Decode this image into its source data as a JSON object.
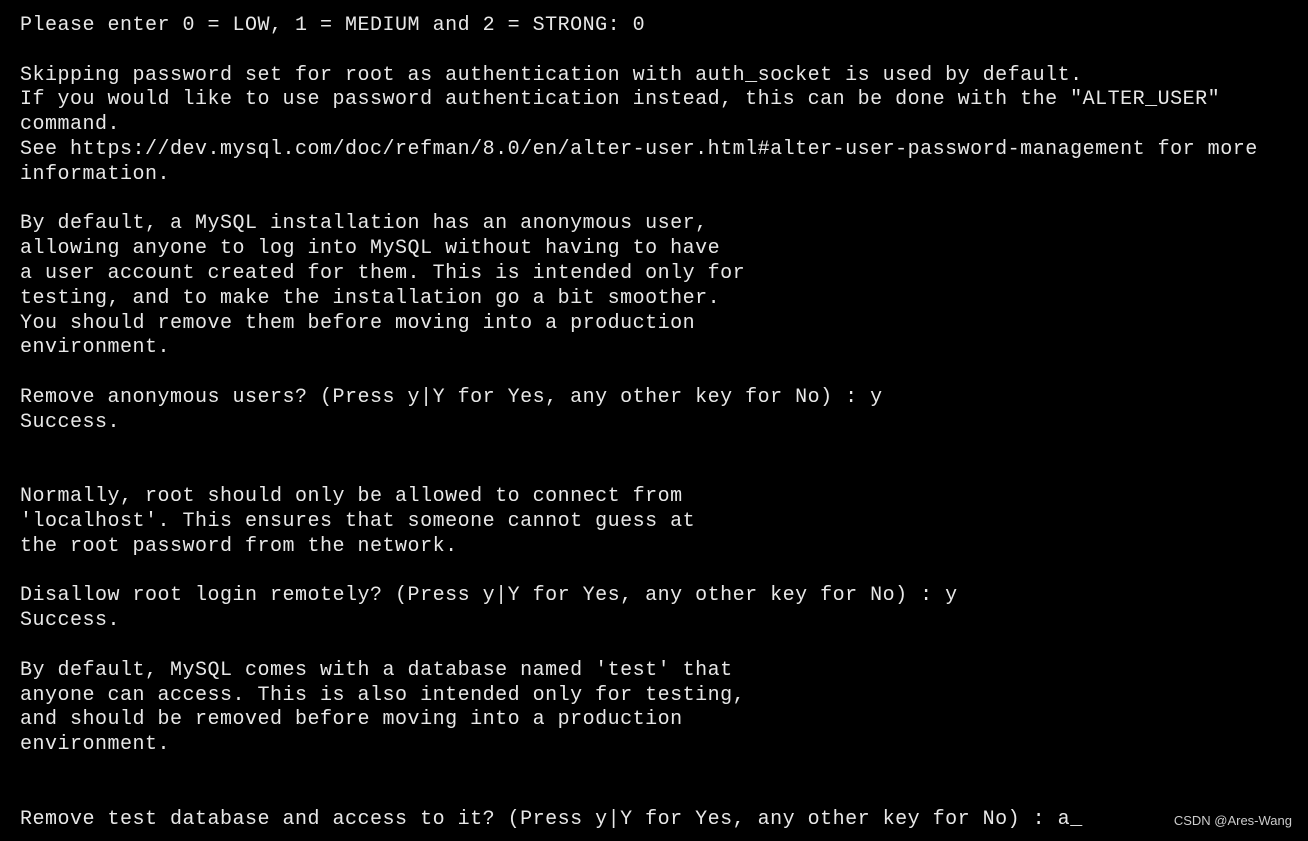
{
  "terminal": {
    "lines": [
      {
        "type": "prompt",
        "text": "Please enter 0 = LOW, 1 = MEDIUM and 2 = STRONG: ",
        "input": "0"
      },
      {
        "type": "blank"
      },
      {
        "type": "text",
        "text": "Skipping password set for root as authentication with auth_socket is used by default."
      },
      {
        "type": "text",
        "text": "If you would like to use password authentication instead, this can be done with the \"ALTER_USER\" command."
      },
      {
        "type": "text",
        "text": "See https://dev.mysql.com/doc/refman/8.0/en/alter-user.html#alter-user-password-management for more information."
      },
      {
        "type": "blank"
      },
      {
        "type": "text",
        "text": "By default, a MySQL installation has an anonymous user,"
      },
      {
        "type": "text",
        "text": "allowing anyone to log into MySQL without having to have"
      },
      {
        "type": "text",
        "text": "a user account created for them. This is intended only for"
      },
      {
        "type": "text",
        "text": "testing, and to make the installation go a bit smoother."
      },
      {
        "type": "text",
        "text": "You should remove them before moving into a production"
      },
      {
        "type": "text",
        "text": "environment."
      },
      {
        "type": "blank"
      },
      {
        "type": "prompt",
        "text": "Remove anonymous users? (Press y|Y for Yes, any other key for No) : ",
        "input": "y"
      },
      {
        "type": "text",
        "text": "Success."
      },
      {
        "type": "blank"
      },
      {
        "type": "blank"
      },
      {
        "type": "text",
        "text": "Normally, root should only be allowed to connect from"
      },
      {
        "type": "text",
        "text": "'localhost'. This ensures that someone cannot guess at"
      },
      {
        "type": "text",
        "text": "the root password from the network."
      },
      {
        "type": "blank"
      },
      {
        "type": "prompt",
        "text": "Disallow root login remotely? (Press y|Y for Yes, any other key for No) : ",
        "input": "y"
      },
      {
        "type": "text",
        "text": "Success."
      },
      {
        "type": "blank"
      },
      {
        "type": "text",
        "text": "By default, MySQL comes with a database named 'test' that"
      },
      {
        "type": "text",
        "text": "anyone can access. This is also intended only for testing,"
      },
      {
        "type": "text",
        "text": "and should be removed before moving into a production"
      },
      {
        "type": "text",
        "text": "environment."
      },
      {
        "type": "blank"
      },
      {
        "type": "blank"
      },
      {
        "type": "prompt-active",
        "text": "Remove test database and access to it? (Press y|Y for Yes, any other key for No) : ",
        "input": "a",
        "cursor": "_"
      }
    ]
  },
  "watermark": "CSDN @Ares-Wang"
}
